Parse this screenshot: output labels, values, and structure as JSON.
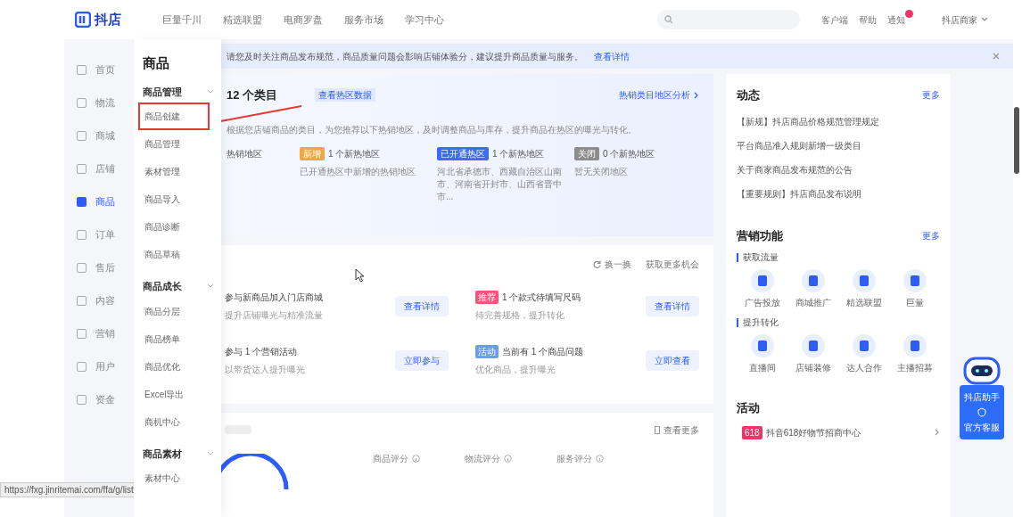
{
  "header": {
    "logo": "抖店",
    "nav": [
      "巨量千川",
      "精选联盟",
      "电商罗盘",
      "服务市场",
      "学习中心"
    ],
    "actions": [
      {
        "label": "客户端",
        "badge": false
      },
      {
        "label": "帮助",
        "badge": false
      },
      {
        "label": "通知",
        "badge": true
      }
    ],
    "shop": "抖店商家"
  },
  "banner": {
    "text": "请您及时关注商品发布规范，商品质量问题会影响店铺体验分，建议提升商品质量与服务。",
    "link": "查看详情"
  },
  "sidebar": {
    "items": [
      {
        "label": "首页",
        "selected": false
      },
      {
        "label": "物流",
        "selected": false
      },
      {
        "label": "商城",
        "selected": false
      },
      {
        "label": "店铺",
        "selected": false
      },
      {
        "label": "商品",
        "selected": true
      },
      {
        "label": "订单",
        "selected": false
      },
      {
        "label": "售后",
        "selected": false
      },
      {
        "label": "内容",
        "selected": false
      },
      {
        "label": "营销",
        "selected": false
      },
      {
        "label": "用户",
        "selected": false
      },
      {
        "label": "资金",
        "selected": false
      }
    ]
  },
  "flyout": {
    "title": "商品",
    "groups": [
      {
        "title": "商品管理",
        "items": [
          {
            "label": "商品创建",
            "annotated": true
          },
          {
            "label": "商品管理",
            "annotated": false
          },
          {
            "label": "素材管理",
            "annotated": false
          },
          {
            "label": "商品导入",
            "annotated": false
          },
          {
            "label": "商品诊断",
            "annotated": false
          },
          {
            "label": "商品草稿",
            "annotated": false
          }
        ]
      },
      {
        "title": "商品成长",
        "items": [
          {
            "label": "商品分层",
            "annotated": false
          },
          {
            "label": "商品榜单",
            "annotated": false
          },
          {
            "label": "商品优化",
            "annotated": false
          },
          {
            "label": "Excel导出",
            "annotated": false
          },
          {
            "label": "商机中心",
            "annotated": false
          }
        ]
      },
      {
        "title": "商品素材",
        "items": [
          {
            "label": "素材中心",
            "annotated": false
          }
        ]
      }
    ]
  },
  "hot_regions": {
    "title": "12 个类目",
    "link": "查看热区数据",
    "more": "热销类目地区分析",
    "description": "根据您店铺商品的类目，为您推荐以下热销地区，及时调整商品与库存，提升商品在热区的曝光与转化。",
    "first_label": "热销地区",
    "columns": [
      {
        "tag": "新增",
        "color": "#f5a63a",
        "count": "1 个新热地区",
        "desc": "已开通热区中新增的热销地区"
      },
      {
        "tag": "已开通热区",
        "color": "#3b6cf6",
        "count": "1 个新热地区",
        "desc": "河北省承德市、西藏自治区山南市、河南省开封市、山西省晋中市..."
      },
      {
        "tag": "关闭",
        "color": "#8c8c8c",
        "count": "0 个新热地区",
        "desc": "暂无关闭地区"
      }
    ]
  },
  "opportunities": {
    "refresh": "换一换",
    "more": "获取更多机会",
    "cards": [
      {
        "title": "参与新商品加入门店商城",
        "desc": "提升店铺曝光与精准流量",
        "button": "查看详情"
      },
      {
        "tag": "推荐",
        "color": "#f0567a",
        "title": "1 个款式待填写尺码",
        "desc": "待完善规格，提升转化",
        "button": "查看详情"
      },
      {
        "title": "参与 1 个营销活动",
        "desc": "以带货达人提升曝光",
        "button": "立即参与"
      },
      {
        "tag": "活动",
        "color": "#6a9cf6",
        "title": "当前有 1 个商品问题",
        "desc": "优化商品，提升曝光",
        "button": "立即查看"
      }
    ]
  },
  "scores": {
    "more": "查看更多",
    "items": [
      "商品评分",
      "物流评分",
      "服务评分"
    ]
  },
  "news": {
    "title": "动态",
    "more": "更多",
    "items": [
      "【新规】抖店商品价格规范管理规定",
      "平台商品准入规则新增一级类目",
      "关于商家商品发布规范的公告",
      "【重要规则】抖店商品发布说明"
    ]
  },
  "marketing": {
    "title": "营销功能",
    "more": "更多",
    "groups": [
      {
        "title": "获取流量",
        "items": [
          "广告投放",
          "商城推广",
          "精选联盟",
          "巨量"
        ]
      },
      {
        "title": "提升转化",
        "items": [
          "直播间",
          "店铺装修",
          "达人合作",
          "主播招募"
        ]
      }
    ]
  },
  "activities": {
    "title": "活动",
    "items": [
      {
        "tag": "618",
        "text": "抖音618好物节招商中心"
      }
    ]
  },
  "assistant": {
    "label": "抖店助手",
    "service": "官方客服"
  },
  "status_url": "https://fxg.jinritemai.com/ffa/g/list"
}
